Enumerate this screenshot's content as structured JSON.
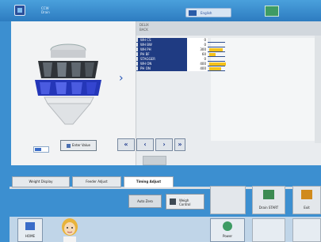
{
  "header": {
    "model": "CCW\nDrain",
    "language": "English",
    "status": "",
    "clock": ""
  },
  "table": {
    "title_1": "DELIX",
    "title_2": "BACK",
    "rows": [
      {
        "name": "WH CS",
        "value": "0",
        "bar": 0
      },
      {
        "name": "WH BW",
        "value": "0",
        "bar": 0
      },
      {
        "name": "WH PH",
        "value": "300",
        "bar": 0.55
      },
      {
        "name": "PH BF",
        "value": "60",
        "bar": 0.25
      },
      {
        "name": "STAGGER",
        "value": "0",
        "bar": 0
      },
      {
        "name": "WH ON",
        "value": "400",
        "bar": 0.7
      },
      {
        "name": "PH ON",
        "value": "400",
        "bar": 0.5
      }
    ]
  },
  "buttons": {
    "enter_value": "Enter Value",
    "nav_first": "«",
    "nav_prev": "‹",
    "nav_next": "›",
    "nav_last": "»",
    "auto_zero": "Auto Zero",
    "weigh_control": "Weigh\nControl",
    "drain_start": "Drain START",
    "exit": "Exit",
    "home": "HOME",
    "power": "Power"
  },
  "tabs": {
    "weight_display": "Weight Display",
    "feeder_adjust": "Feeder Adjust",
    "timing_adjust": "Timing Adjust"
  },
  "colors": {
    "accent": "#1f3b82",
    "bar": "#f5c21a",
    "background": "#3c8fd0"
  }
}
